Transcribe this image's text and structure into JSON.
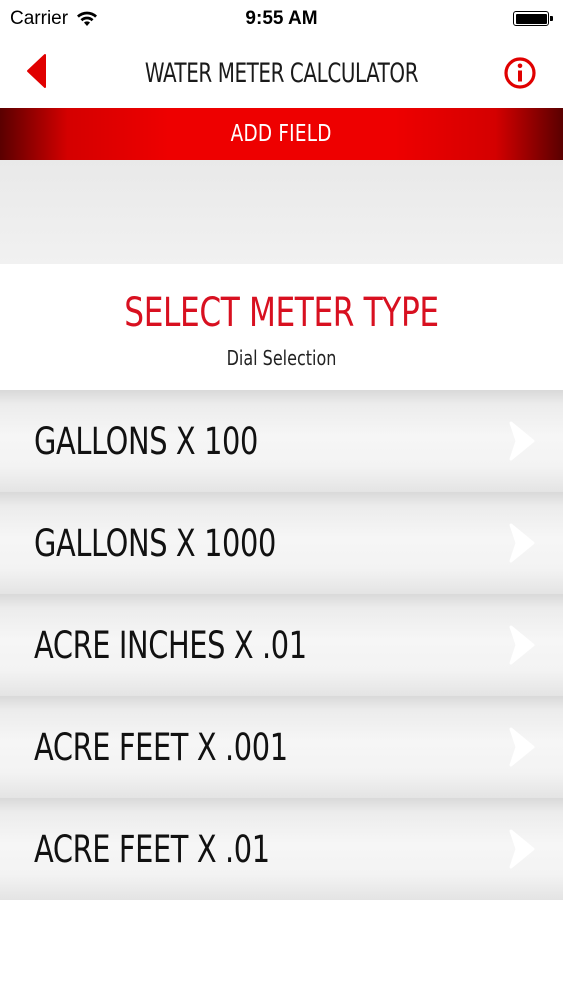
{
  "status_bar": {
    "carrier": "Carrier",
    "time": "9:55 AM",
    "battery_level": 1.0
  },
  "nav": {
    "title": "WATER METER CALCULATOR",
    "back_icon": "chevron-left-icon",
    "info_icon": "info-circle-icon"
  },
  "add_field": {
    "label": "ADD FIELD"
  },
  "header": {
    "title": "SELECT METER TYPE",
    "subtitle": "Dial Selection"
  },
  "meter_types": [
    {
      "label": "GALLONS X 100"
    },
    {
      "label": "GALLONS X 1000"
    },
    {
      "label": "ACRE INCHES X .01"
    },
    {
      "label": "ACRE FEET X .001"
    },
    {
      "label": "ACRE FEET X .01"
    }
  ],
  "colors": {
    "accent_red": "#e00000",
    "title_red": "#d81020",
    "chevron": "#ffffff"
  }
}
